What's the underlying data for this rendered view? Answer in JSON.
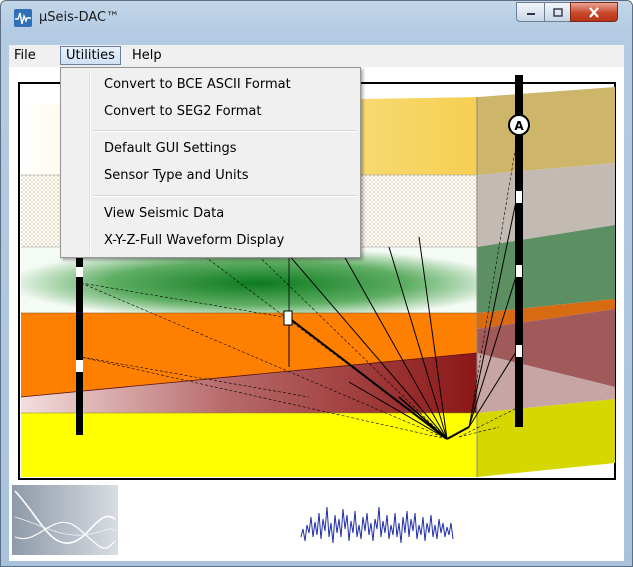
{
  "window": {
    "title": "μSeis-DAC™"
  },
  "menubar": {
    "file": "File",
    "utilities": "Utilities",
    "help": "Help"
  },
  "utilities_menu": {
    "convert_bce": "Convert to BCE ASCII Format",
    "convert_seg2": "Convert to SEG2 Format",
    "default_gui": "Default GUI Settings",
    "sensor_type": "Sensor Type and Units",
    "view_seismic": "View Seismic Data",
    "xyz_waveform": "X-Y-Z-Full Waveform Display"
  },
  "scene": {
    "source_marker": "A"
  },
  "colors": {
    "layer_top": "#f6cf52",
    "layer_green": "#1f8a2a",
    "layer_orange": "#ff8000",
    "layer_red": "#8c1616",
    "layer_yellow": "#ffff00",
    "waveform": "#1f2fa8",
    "close_button": "#c9482a"
  }
}
